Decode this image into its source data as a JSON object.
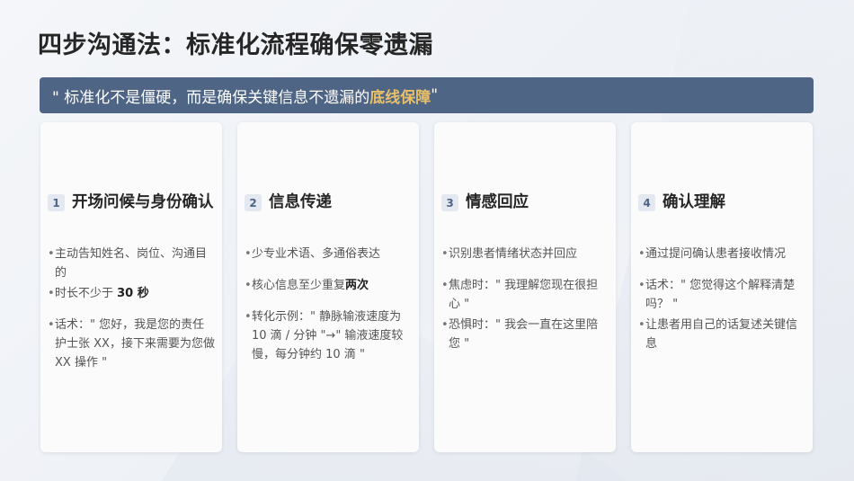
{
  "title": "四步沟通法：标准化流程确保零遗漏",
  "banner": {
    "prefix": "\" 标准化不是僵硬，而是确保关键信息不遗漏的",
    "highlight": "底线保障",
    "suffix": " \""
  },
  "colors": {
    "banner_bg": "#4f6585",
    "highlight": "#e8c06a"
  },
  "steps": [
    {
      "num": "1",
      "title": "开场问候与身份确认",
      "p1": "主动告知姓名、岗位、沟通目的",
      "p2_pre": "时长不少于 ",
      "p2_bold": "30 秒",
      "p3": "话术：\" 您好，我是您的责任护士张 XX，接下来需要为您做 XX 操作 \""
    },
    {
      "num": "2",
      "title": "信息传递",
      "p1": "少专业术语、多通俗表达",
      "p2_pre": "核心信息至少重复",
      "p2_bold": "两次",
      "p3": "转化示例：\" 静脉输液速度为 10 滴 / 分钟 \"→\" 输液速度较慢，每分钟约 10 滴 \""
    },
    {
      "num": "3",
      "title": "情感回应",
      "p1": "识别患者情绪状态并回应",
      "p2": "焦虑时：\" 我理解您现在很担心 \"",
      "p3": "恐惧时：\" 我会一直在这里陪您 \""
    },
    {
      "num": "4",
      "title": "确认理解",
      "p1": "通过提问确认患者接收情况",
      "p2": "话术：\" 您觉得这个解释清楚吗？ \"",
      "p3": "让患者用自己的话复述关键信息"
    }
  ]
}
